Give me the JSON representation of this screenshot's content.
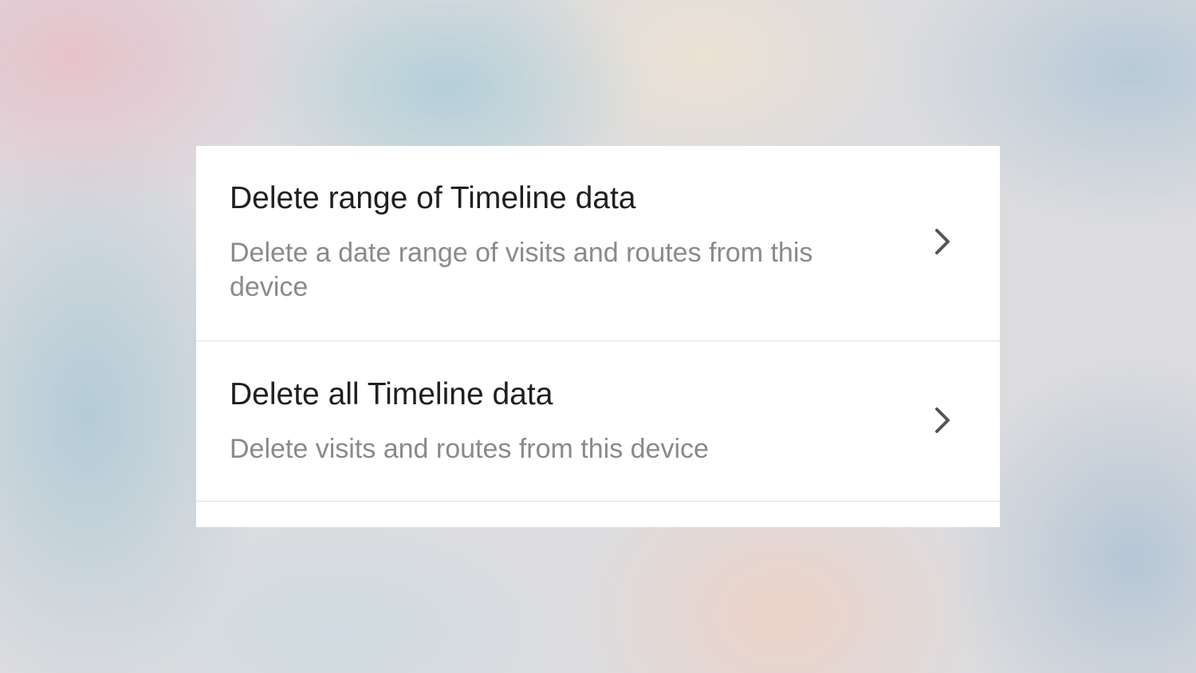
{
  "settings_list": {
    "items": [
      {
        "title": "Delete range of Timeline data",
        "description": "Delete a date range of visits and routes from this device",
        "icon": "chevron-right-icon"
      },
      {
        "title": "Delete all Timeline data",
        "description": "Delete visits and routes from this device",
        "icon": "chevron-right-icon"
      }
    ]
  },
  "colors": {
    "card_background": "#ffffff",
    "title_text": "#1f1f1f",
    "description_text": "#8a8a8a",
    "chevron": "#555555",
    "divider": "#dedede"
  }
}
